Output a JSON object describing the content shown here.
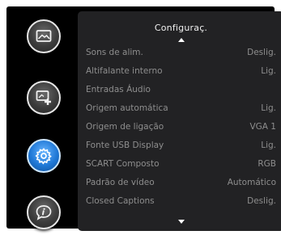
{
  "sidebar": {
    "items": [
      {
        "icon": "picture-icon",
        "active": false
      },
      {
        "icon": "add-screen-icon",
        "active": false
      },
      {
        "icon": "gear-icon",
        "active": true
      },
      {
        "icon": "info-icon",
        "active": false
      }
    ]
  },
  "panel": {
    "title": "Configuraç.",
    "rows": [
      {
        "label": "Sons de alim.",
        "value": "Deslig."
      },
      {
        "label": "Altifalante interno",
        "value": "Lig."
      },
      {
        "label": "Entradas Áudio",
        "value": ""
      },
      {
        "label": "Origem automática",
        "value": "Lig."
      },
      {
        "label": "Origem de ligação",
        "value": "VGA 1"
      },
      {
        "label": "Fonte USB Display",
        "value": "Lig."
      },
      {
        "label": "SCART Composto",
        "value": "RGB"
      },
      {
        "label": "Padrão de vídeo",
        "value": "Automático"
      },
      {
        "label": "Closed Captions",
        "value": "Deslig."
      }
    ]
  },
  "colors": {
    "background": "#000000",
    "panel": "#222224",
    "text_dim": "#8e8e8e",
    "title": "#f0f0f0",
    "active_accent": "#1f78d6"
  }
}
